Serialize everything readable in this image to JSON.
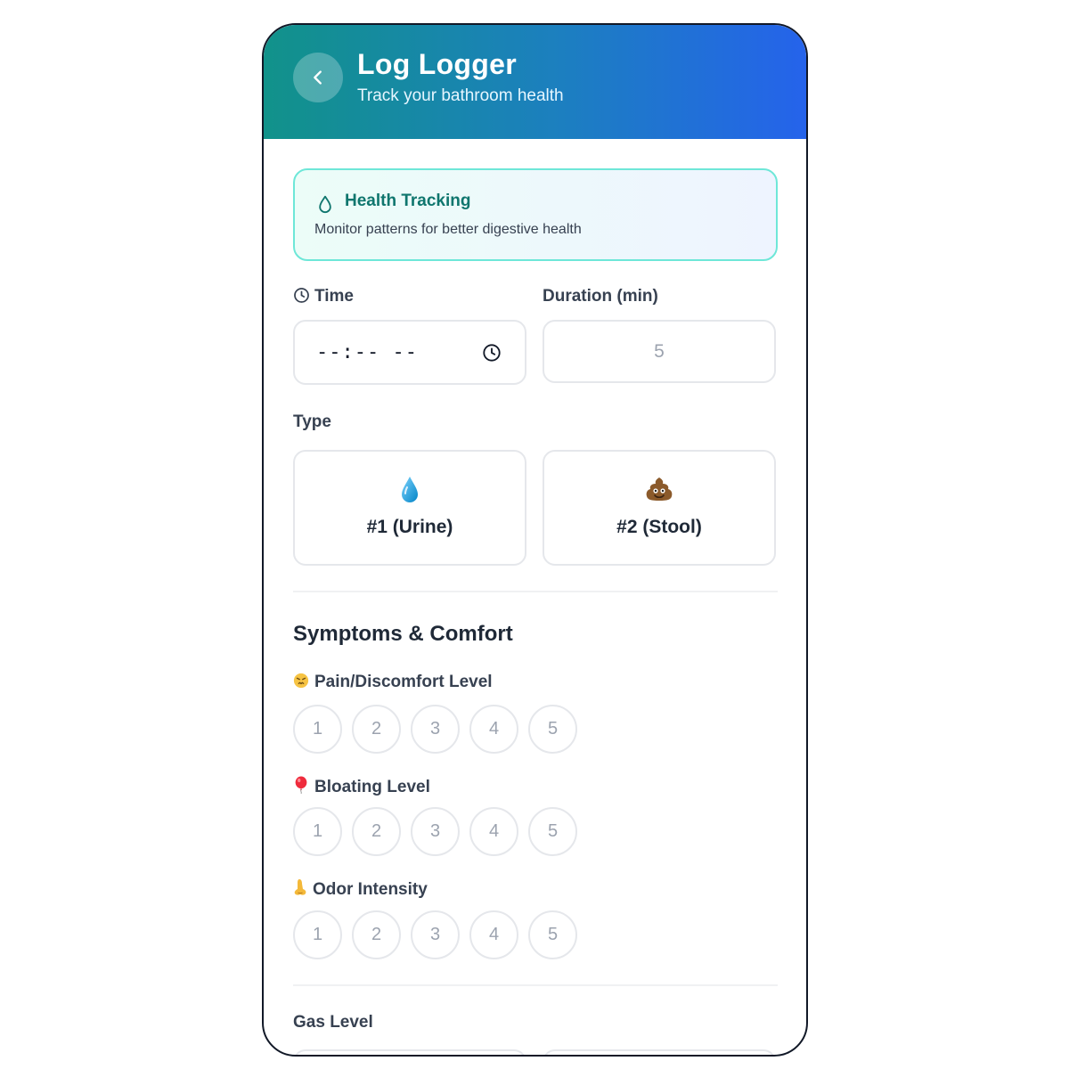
{
  "header": {
    "title": "Log Logger",
    "subtitle": "Track your bathroom health"
  },
  "info_card": {
    "title": "Health Tracking",
    "description": "Monitor patterns for better digestive health"
  },
  "time": {
    "label": "Time",
    "value": "--:-- --"
  },
  "duration": {
    "label": "Duration (min)",
    "placeholder": "5"
  },
  "type": {
    "label": "Type",
    "options": [
      {
        "label": "#1 (Urine)",
        "icon": "droplet-icon"
      },
      {
        "label": "#2 (Stool)",
        "icon": "poop-icon"
      }
    ]
  },
  "symptoms": {
    "title": "Symptoms & Comfort",
    "pain": {
      "label": "Pain/Discomfort Level",
      "icon": "persevering-face-icon",
      "options": [
        "1",
        "2",
        "3",
        "4",
        "5"
      ]
    },
    "bloating": {
      "label": "Bloating Level",
      "icon": "balloon-icon",
      "options": [
        "1",
        "2",
        "3",
        "4",
        "5"
      ]
    },
    "odor": {
      "label": "Odor Intensity",
      "icon": "nose-icon",
      "options": [
        "1",
        "2",
        "3",
        "4",
        "5"
      ]
    }
  },
  "gas": {
    "label": "Gas Level"
  },
  "colors": {
    "header_start": "#11928a",
    "header_end": "#2563eb",
    "card_border": "#6ee7d8",
    "accent_text": "#0f766e"
  }
}
